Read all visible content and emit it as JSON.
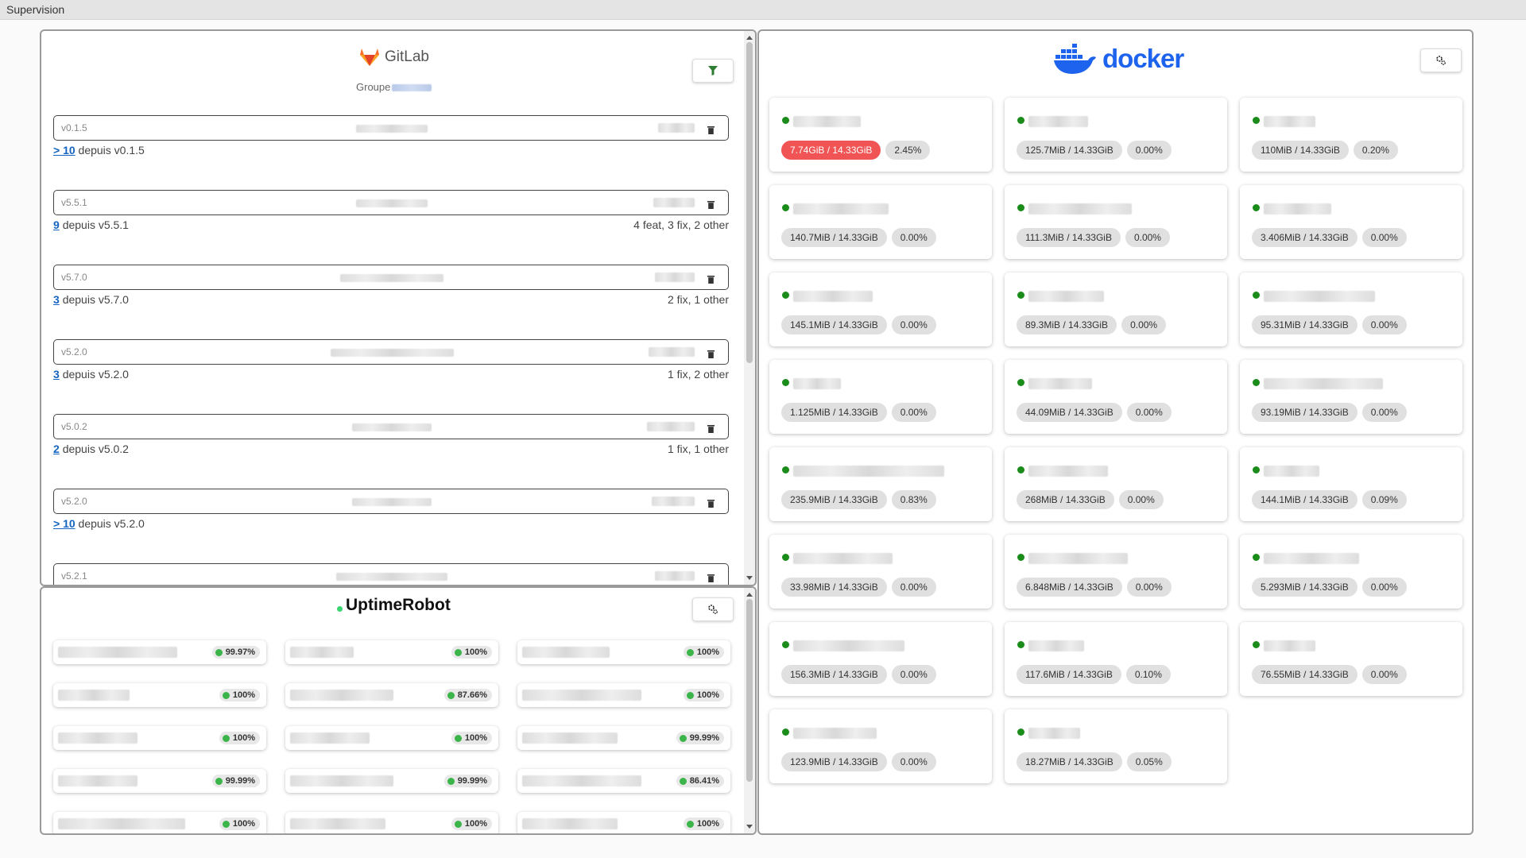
{
  "window": {
    "title": "Supervision"
  },
  "colors": {
    "gitlab_orange": "#e24329",
    "docker_blue": "#1d63ed",
    "uptime_green": "#3bd671",
    "status_running": "#1a8c1a",
    "alert_red": "#f05454",
    "link_blue": "#1565c0"
  },
  "gitlab": {
    "brand": "GitLab",
    "group_label": "Groupe",
    "filter_icon": "filter-icon",
    "releases": [
      {
        "tag": "v0.1.5",
        "commits_link": "> 10",
        "since_text": "depuis v0.1.5",
        "changes": ""
      },
      {
        "tag": "v5.5.1",
        "commits_link": "9",
        "since_text": "depuis v5.5.1",
        "changes": "4 feat, 3 fix, 2 other"
      },
      {
        "tag": "v5.7.0",
        "commits_link": "3",
        "since_text": "depuis v5.7.0",
        "changes": "2 fix, 1 other"
      },
      {
        "tag": "v5.2.0",
        "commits_link": "3",
        "since_text": "depuis v5.2.0",
        "changes": "1 fix, 2 other"
      },
      {
        "tag": "v5.0.2",
        "commits_link": "2",
        "since_text": "depuis v5.0.2",
        "changes": "1 fix, 1 other"
      },
      {
        "tag": "v5.2.0",
        "commits_link": "> 10",
        "since_text": "depuis v5.2.0",
        "changes": ""
      },
      {
        "tag": "v5.2.1",
        "commits_link": "",
        "since_text": "",
        "changes": ""
      }
    ]
  },
  "uptime": {
    "brand": "UptimeRobot",
    "settings_icon": "gear-icon",
    "monitors": [
      {
        "uptime": "99.97%"
      },
      {
        "uptime": "100%"
      },
      {
        "uptime": "100%"
      },
      {
        "uptime": "100%"
      },
      {
        "uptime": "87.66%"
      },
      {
        "uptime": "100%"
      },
      {
        "uptime": "100%"
      },
      {
        "uptime": "100%"
      },
      {
        "uptime": "99.99%"
      },
      {
        "uptime": "99.99%"
      },
      {
        "uptime": "99.99%"
      },
      {
        "uptime": "86.41%"
      },
      {
        "uptime": "100%"
      },
      {
        "uptime": "100%"
      },
      {
        "uptime": "100%"
      }
    ]
  },
  "docker": {
    "brand": "docker",
    "settings_icon": "gear-icon",
    "containers": [
      {
        "memory": "7.74GiB / 14.33GiB",
        "cpu": "2.45%",
        "alert": true
      },
      {
        "memory": "125.7MiB / 14.33GiB",
        "cpu": "0.00%",
        "alert": false
      },
      {
        "memory": "110MiB / 14.33GiB",
        "cpu": "0.20%",
        "alert": false
      },
      {
        "memory": "140.7MiB / 14.33GiB",
        "cpu": "0.00%",
        "alert": false
      },
      {
        "memory": "111.3MiB / 14.33GiB",
        "cpu": "0.00%",
        "alert": false
      },
      {
        "memory": "3.406MiB / 14.33GiB",
        "cpu": "0.00%",
        "alert": false
      },
      {
        "memory": "145.1MiB / 14.33GiB",
        "cpu": "0.00%",
        "alert": false
      },
      {
        "memory": "89.3MiB / 14.33GiB",
        "cpu": "0.00%",
        "alert": false
      },
      {
        "memory": "95.31MiB / 14.33GiB",
        "cpu": "0.00%",
        "alert": false
      },
      {
        "memory": "1.125MiB / 14.33GiB",
        "cpu": "0.00%",
        "alert": false
      },
      {
        "memory": "44.09MiB / 14.33GiB",
        "cpu": "0.00%",
        "alert": false
      },
      {
        "memory": "93.19MiB / 14.33GiB",
        "cpu": "0.00%",
        "alert": false
      },
      {
        "memory": "235.9MiB / 14.33GiB",
        "cpu": "0.83%",
        "alert": false
      },
      {
        "memory": "268MiB / 14.33GiB",
        "cpu": "0.00%",
        "alert": false
      },
      {
        "memory": "144.1MiB / 14.33GiB",
        "cpu": "0.09%",
        "alert": false
      },
      {
        "memory": "33.98MiB / 14.33GiB",
        "cpu": "0.00%",
        "alert": false
      },
      {
        "memory": "6.848MiB / 14.33GiB",
        "cpu": "0.00%",
        "alert": false
      },
      {
        "memory": "5.293MiB / 14.33GiB",
        "cpu": "0.00%",
        "alert": false
      },
      {
        "memory": "156.3MiB / 14.33GiB",
        "cpu": "0.00%",
        "alert": false
      },
      {
        "memory": "117.6MiB / 14.33GiB",
        "cpu": "0.10%",
        "alert": false
      },
      {
        "memory": "76.55MiB / 14.33GiB",
        "cpu": "0.00%",
        "alert": false
      },
      {
        "memory": "123.9MiB / 14.33GiB",
        "cpu": "0.00%",
        "alert": false
      },
      {
        "memory": "18.27MiB / 14.33GiB",
        "cpu": "0.05%",
        "alert": false
      }
    ]
  }
}
